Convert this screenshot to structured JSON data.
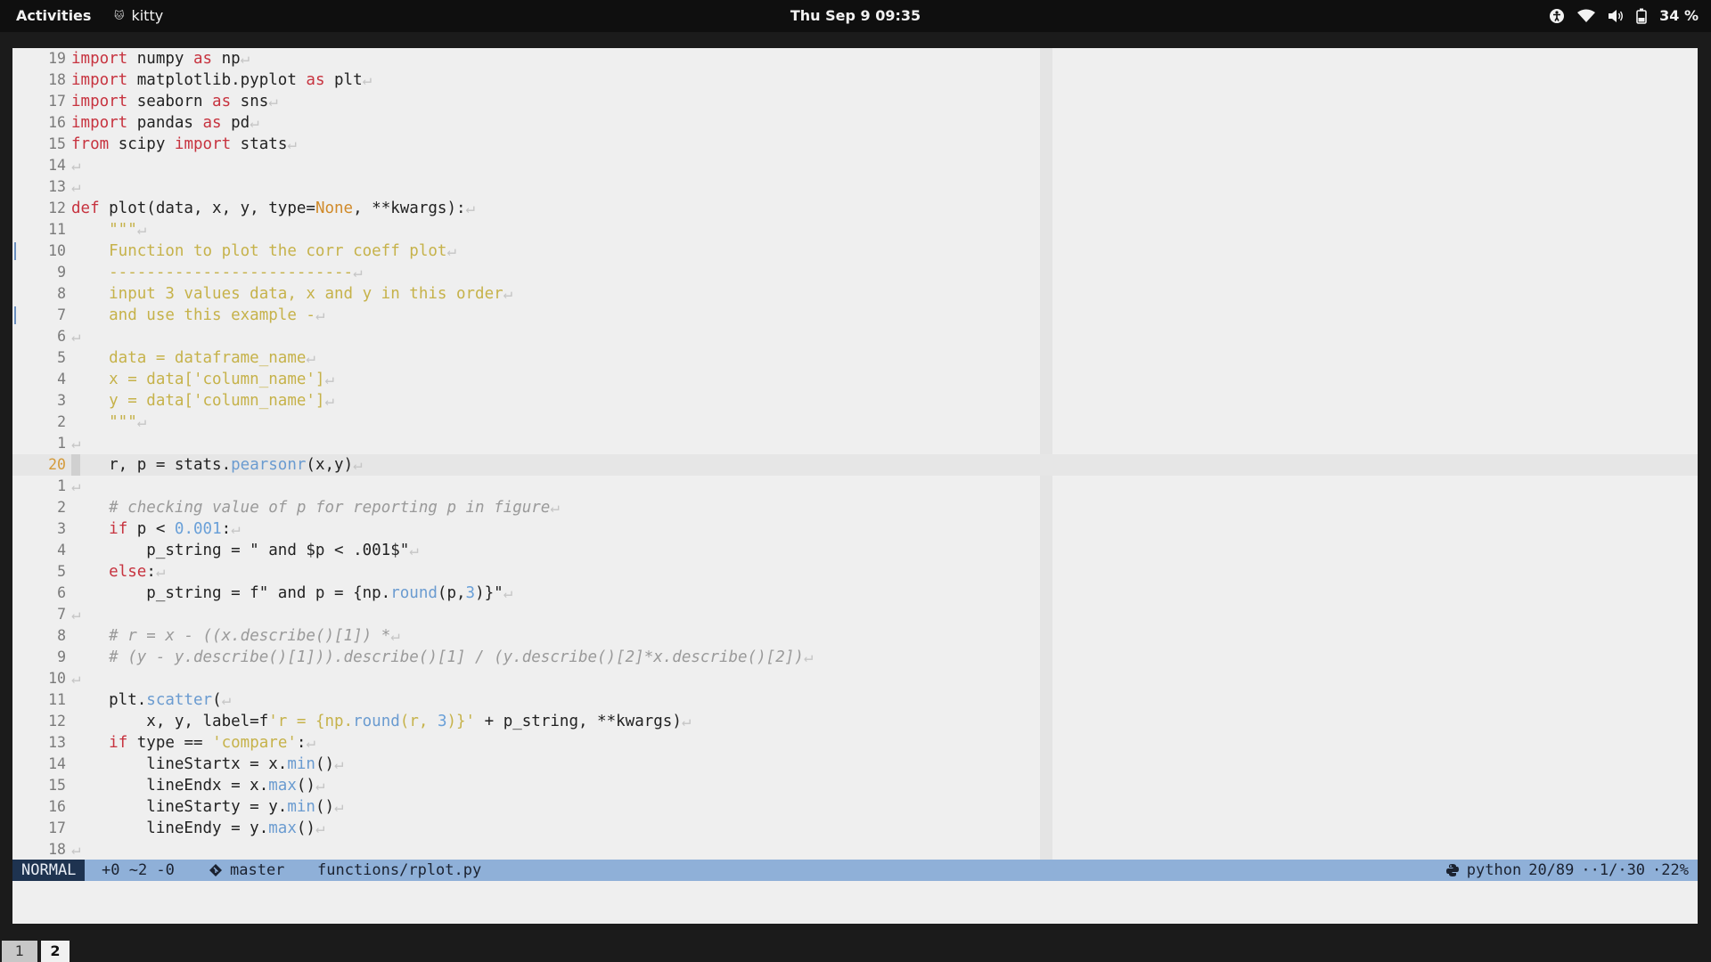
{
  "topbar": {
    "activities": "Activities",
    "app_name": "kitty",
    "clock": "Thu Sep 9  09:35",
    "battery": "34 %"
  },
  "editor": {
    "lines": [
      {
        "num": "19",
        "code": "import numpy as np"
      },
      {
        "num": "18",
        "code": "import matplotlib.pyplot as plt"
      },
      {
        "num": "17",
        "code": "import seaborn as sns"
      },
      {
        "num": "16",
        "code": "import pandas as pd"
      },
      {
        "num": "15",
        "code": "from scipy import stats"
      },
      {
        "num": "14",
        "code": ""
      },
      {
        "num": "13",
        "code": ""
      },
      {
        "num": "12",
        "code": "def plot(data, x, y, type=None, **kwargs):"
      },
      {
        "num": "11",
        "code": "    \"\"\""
      },
      {
        "num": "10",
        "code": "    Function to plot the corr coeff plot"
      },
      {
        "num": "9",
        "code": "    --------------------------"
      },
      {
        "num": "8",
        "code": "    input 3 values data, x and y in this order"
      },
      {
        "num": "7",
        "code": "    and use this example -"
      },
      {
        "num": "6",
        "code": ""
      },
      {
        "num": "5",
        "code": "    data = dataframe_name"
      },
      {
        "num": "4",
        "code": "    x = data['column_name']"
      },
      {
        "num": "3",
        "code": "    y = data['column_name']"
      },
      {
        "num": "2",
        "code": "    \"\"\""
      },
      {
        "num": "1",
        "code": ""
      },
      {
        "num": "20",
        "code": "    r, p = stats.pearsonr(x,y)"
      },
      {
        "num": "1",
        "code": ""
      },
      {
        "num": "2",
        "code": "    # checking value of p for reporting p in figure"
      },
      {
        "num": "3",
        "code": "    if p < 0.001:"
      },
      {
        "num": "4",
        "code": "        p_string = \" and $p < .001$\""
      },
      {
        "num": "5",
        "code": "    else:"
      },
      {
        "num": "6",
        "code": "        p_string = f\" and p = {np.round(p,3)}\""
      },
      {
        "num": "7",
        "code": ""
      },
      {
        "num": "8",
        "code": "    # r = x - ((x.describe()[1]) *"
      },
      {
        "num": "9",
        "code": "    # (y - y.describe()[1])).describe()[1] / (y.describe()[2]*x.describe()[2])"
      },
      {
        "num": "10",
        "code": ""
      },
      {
        "num": "11",
        "code": "    plt.scatter("
      },
      {
        "num": "12",
        "code": "        x, y, label=f'r = {np.round(r, 3)}' + p_string, **kwargs)"
      },
      {
        "num": "13",
        "code": "    if type == 'compare':"
      },
      {
        "num": "14",
        "code": "        lineStartx = x.min()"
      },
      {
        "num": "15",
        "code": "        lineEndx = x.max()"
      },
      {
        "num": "16",
        "code": "        lineStarty = y.min()"
      },
      {
        "num": "17",
        "code": "        lineEndy = y.max()"
      },
      {
        "num": "18",
        "code": ""
      }
    ]
  },
  "statusline": {
    "mode": "NORMAL",
    "diff": "+0 ~2 -0",
    "branch": "master",
    "file": "functions/rplot.py",
    "filetype": "python",
    "position": "20/89",
    "column": "··1/·30",
    "percent": "·22%"
  },
  "tabs": [
    "1",
    "2"
  ]
}
